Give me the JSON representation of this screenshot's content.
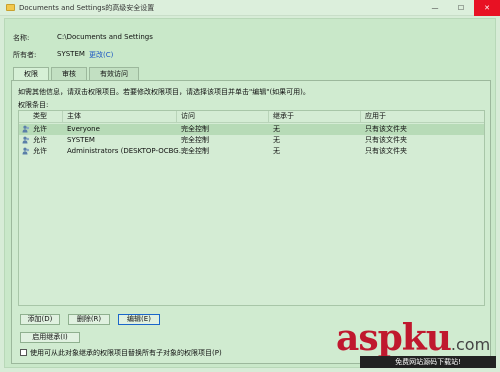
{
  "window": {
    "title": "Documents and Settings的高级安全设置",
    "minimize": "—",
    "maximize": "☐",
    "close": "✕"
  },
  "details": {
    "name_label": "名称:",
    "name_value": "C:\\Documents and Settings",
    "owner_label": "所有者:",
    "owner_value": "SYSTEM",
    "change_link": "更改(C)"
  },
  "tabs": [
    {
      "label": "权限"
    },
    {
      "label": "审核"
    },
    {
      "label": "有效访问"
    }
  ],
  "info_text": "如需其他信息，请双击权限项目。若要修改权限项目，请选择该项目并单击\"编辑\"(如果可用)。",
  "entries_label": "权限条目:",
  "table": {
    "columns": [
      "类型",
      "主体",
      "访问",
      "继承于",
      "应用于"
    ],
    "rows": [
      {
        "type": "允许",
        "principal": "Everyone",
        "access": "完全控制",
        "inherited": "无",
        "applies": "只有该文件夹"
      },
      {
        "type": "允许",
        "principal": "SYSTEM",
        "access": "完全控制",
        "inherited": "无",
        "applies": "只有该文件夹"
      },
      {
        "type": "允许",
        "principal": "Administrators (DESKTOP-OCBG...",
        "access": "完全控制",
        "inherited": "无",
        "applies": "只有该文件夹"
      }
    ]
  },
  "buttons": {
    "add": "添加(D)",
    "remove": "删除(R)",
    "edit": "编辑(E)",
    "enable_inheritance": "启用继承(I)"
  },
  "replace_checkbox_label": "使用可从此对象继承的权限项目替换所有子对象的权限项目(P)",
  "watermark": {
    "main": "aspku",
    "suffix": ".com",
    "sub": "免费网站源码下载站!"
  },
  "colors": {
    "background": "#c9e8c9",
    "link": "#1a55c4",
    "watermark_red": "#c0182e"
  }
}
